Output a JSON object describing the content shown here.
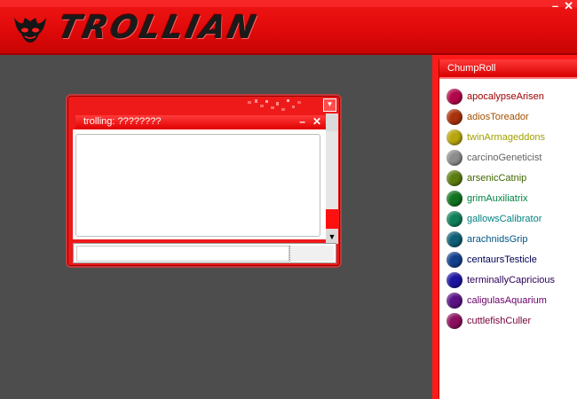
{
  "app": {
    "title": "TROLLIAN",
    "window_controls": [
      "–",
      "✕"
    ]
  },
  "chat_window": {
    "tab_title": "trolling: ????????",
    "tab_minimize": "–",
    "tab_close": "✕",
    "input_value": ""
  },
  "chumroll": {
    "header": "ChumpRoll",
    "chums": [
      {
        "handle": "apocalypseArisen",
        "color": "#a10000"
      },
      {
        "handle": "adiosToreador",
        "color": "#a15000"
      },
      {
        "handle": "twinArmageddons",
        "color": "#a1a100"
      },
      {
        "handle": "carcinoGeneticist",
        "color": "#626262"
      },
      {
        "handle": "arsenicCatnip",
        "color": "#416600"
      },
      {
        "handle": "grimAuxiliatrix",
        "color": "#008141"
      },
      {
        "handle": "gallowsCalibrator",
        "color": "#008282"
      },
      {
        "handle": "arachnidsGrip",
        "color": "#005682"
      },
      {
        "handle": "centaursTesticle",
        "color": "#000056"
      },
      {
        "handle": "terminallyCapricious",
        "color": "#2b0057"
      },
      {
        "handle": "caligulasAquarium",
        "color": "#6a006a"
      },
      {
        "handle": "cuttlefishCuller",
        "color": "#77003c"
      }
    ],
    "dot_colors": [
      "#b3064a",
      "#a9310c",
      "#b7a60e",
      "#8c8c8c",
      "#5b7d10",
      "#11731f",
      "#0f7f5a",
      "#0e5e75",
      "#123f8c",
      "#1b14a0",
      "#5a1183",
      "#8b0f5d"
    ]
  }
}
